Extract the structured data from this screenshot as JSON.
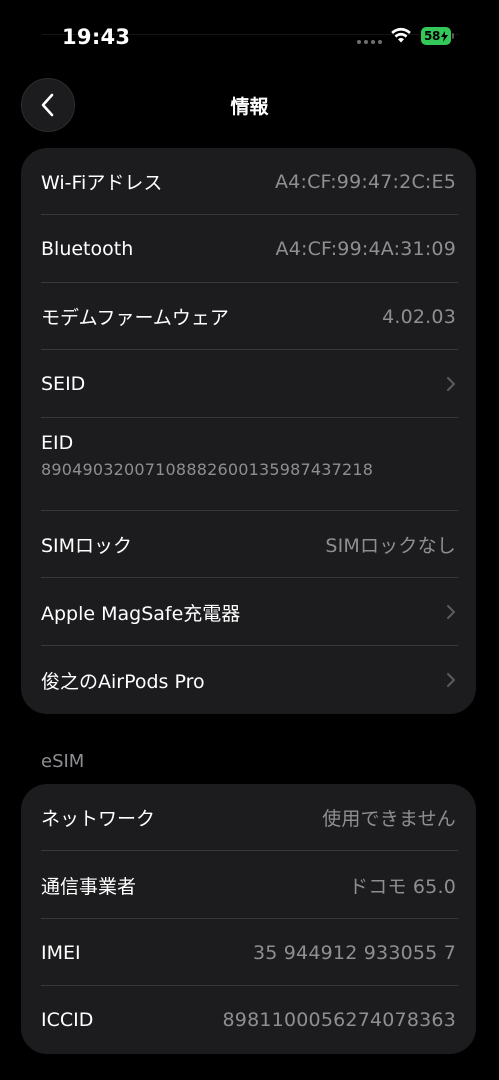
{
  "status_bar": {
    "time": "19:43",
    "battery_percent": "58",
    "battery_color": "#34c759",
    "icons": [
      "signal-dots-icon",
      "wifi-icon",
      "battery-charging-icon"
    ]
  },
  "nav": {
    "title": "情報",
    "back_icon": "chevron-left-icon"
  },
  "info_rows": [
    {
      "label": "Wi-Fiアドレス",
      "value": "A4:CF:99:47:2C:E5"
    },
    {
      "label": "Bluetooth",
      "value": "A4:CF:99:4A:31:09"
    },
    {
      "label": "モデムファームウェア",
      "value": "4.02.03"
    },
    {
      "label": "SEID",
      "chevron": "chevron-right-icon"
    },
    {
      "label": "EID",
      "value": "89049032007108882600135987437218"
    },
    {
      "label": "SIMロック",
      "value": "SIMロックなし"
    },
    {
      "label": "Apple MagSafe充電器",
      "chevron": "chevron-right-icon"
    },
    {
      "label": "俊之のAirPods Pro",
      "chevron": "chevron-right-icon"
    }
  ],
  "esim": {
    "header": "eSIM",
    "rows": [
      {
        "label": "ネットワーク",
        "value": "使用できません"
      },
      {
        "label": "通信事業者",
        "value": "ドコモ 65.0"
      },
      {
        "label": "IMEI",
        "value": "35 944912 933055 7"
      },
      {
        "label": "ICCID",
        "value": "8981100056274078363"
      }
    ]
  },
  "colors": {
    "background": "#000000",
    "card": "#1c1c1e",
    "separator": "#38383a",
    "secondary_text": "#8e8e93"
  }
}
